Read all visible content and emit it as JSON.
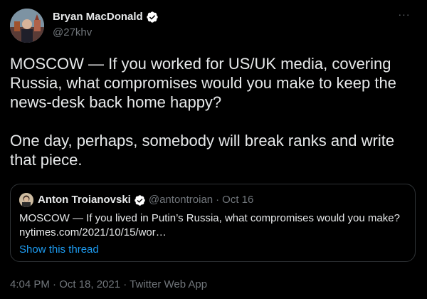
{
  "tweet": {
    "author": {
      "name": "Bryan MacDonald",
      "handle": "@27khv",
      "verified": true,
      "avatar_icon": "profile-photo"
    },
    "more_icon": "ellipsis-icon",
    "more_label": "···",
    "text": "MOSCOW — If you worked for US/UK media, covering Russia, what compromises would you make to keep the news-desk back home happy?\n\nOne day, perhaps, somebody will break ranks and write that piece.",
    "quote": {
      "author_name": "Anton Troianovski",
      "author_handle": "@antontroian",
      "separator": "·",
      "date": "Oct 16",
      "verified": true,
      "text": "MOSCOW — If you lived in Putin’s Russia, what compromises would you make? nytimes.com/2021/10/15/wor…",
      "thread_link": "Show this thread"
    },
    "timestamp": "4:04 PM · Oct 18, 2021 · Twitter Web App"
  },
  "colors": {
    "background": "#000000",
    "text_primary": "#e7e9ea",
    "text_secondary": "#71767b",
    "link": "#1d9bf0",
    "border": "#2f3336",
    "verified_badge": "#ffffff"
  }
}
